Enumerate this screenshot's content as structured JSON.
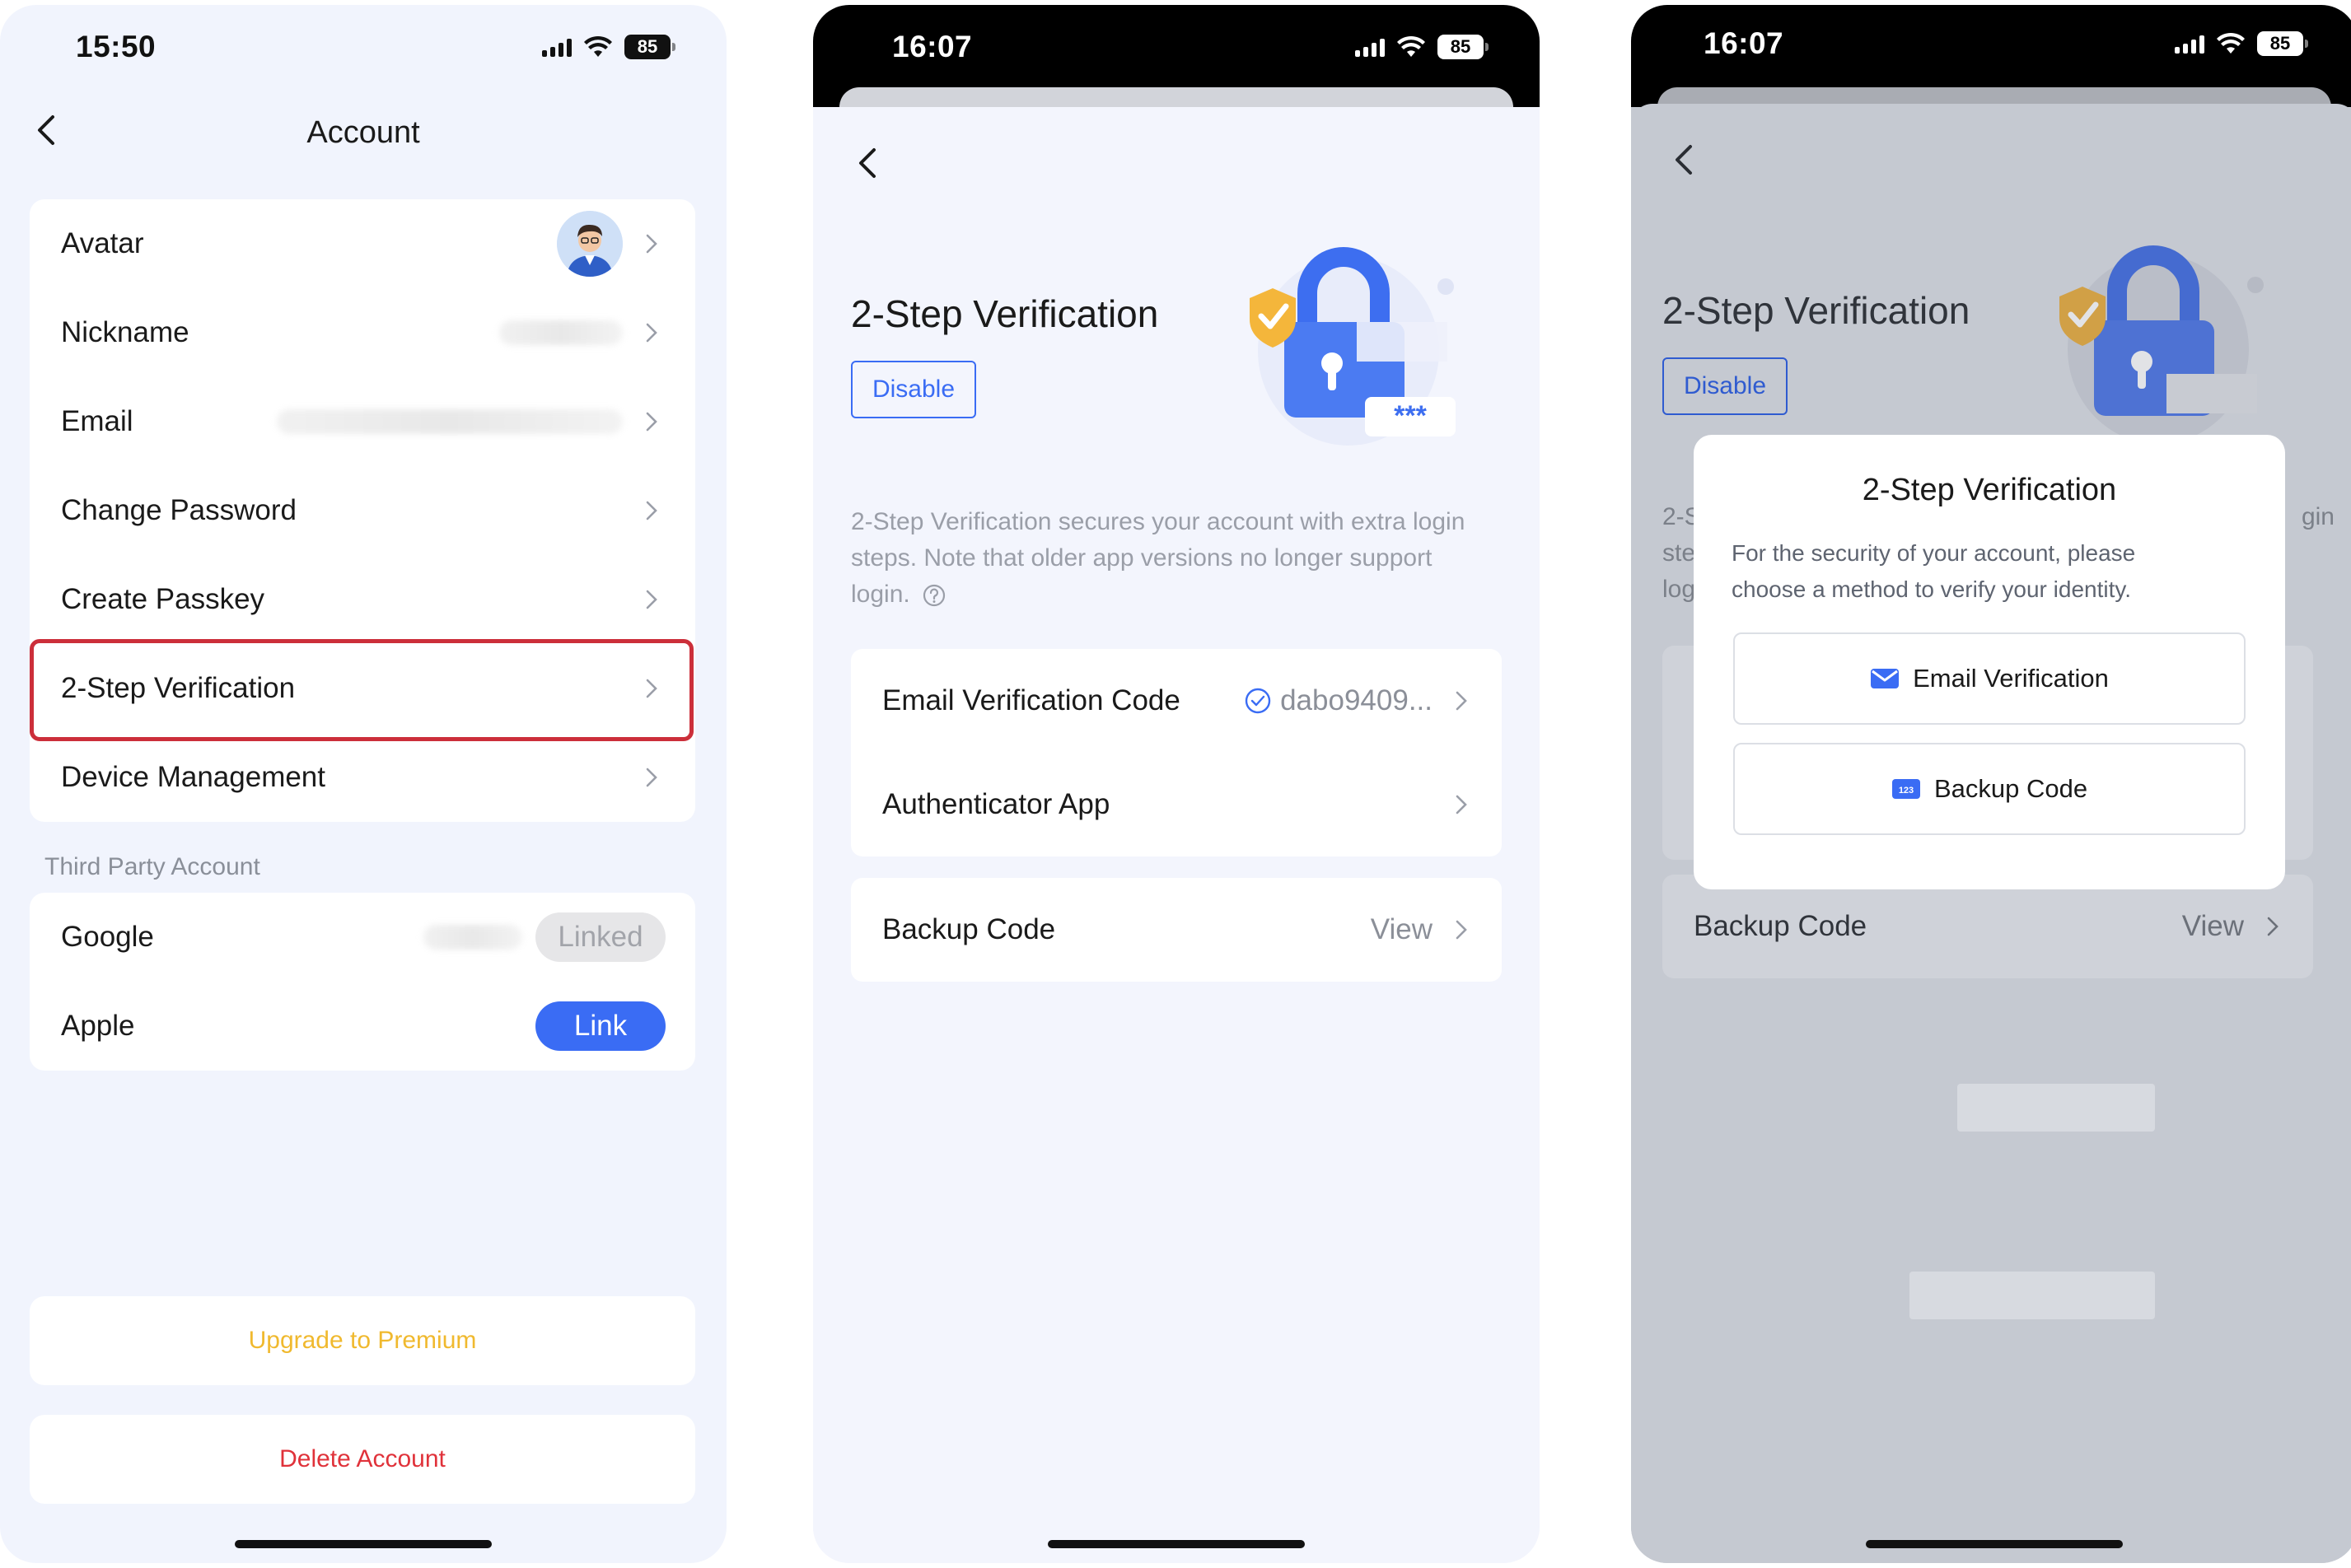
{
  "screens": [
    {
      "status": {
        "time": "15:50",
        "battery": "85"
      },
      "title": "Account",
      "rows": [
        {
          "label": "Avatar"
        },
        {
          "label": "Nickname"
        },
        {
          "label": "Email"
        },
        {
          "label": "Change Password"
        },
        {
          "label": "Create Passkey"
        },
        {
          "label": "2-Step Verification"
        },
        {
          "label": "Device Management"
        }
      ],
      "third_party_label": "Third Party Account",
      "third_party": [
        {
          "label": "Google",
          "action": "Linked"
        },
        {
          "label": "Apple",
          "action": "Link"
        }
      ],
      "upgrade_label": "Upgrade to Premium",
      "delete_label": "Delete Account",
      "colors": {
        "accent": "#3a6cf4",
        "highlight": "#cc2f3a",
        "upgrade": "#f0b92e",
        "delete": "#e0323a"
      }
    },
    {
      "status": {
        "time": "16:07",
        "battery": "85"
      },
      "title": "2-Step Verification",
      "disable_label": "Disable",
      "description_1": "2-Step Verification secures your account with extra login",
      "description_2": "steps. Note that older app versions no longer support",
      "description_3": "login.",
      "email_code_label": "Email Verification Code",
      "email_code_value": "dabo9409...",
      "authenticator_label": "Authenticator App",
      "backup_label": "Backup Code",
      "backup_value": "View"
    },
    {
      "status": {
        "time": "16:07",
        "battery": "85"
      },
      "title": "2-Step Verification",
      "disable_label": "Disable",
      "backup_label": "Backup Code",
      "backup_value": "View",
      "peek_left": [
        "2-S",
        "ste",
        "log"
      ],
      "peek_right": "gin",
      "modal": {
        "title": "2-Step Verification",
        "description_1": "For the security of your account, please",
        "description_2": "choose a method to verify your identity.",
        "option_email": "Email Verification",
        "option_backup": "Backup Code",
        "backup_icon_text": "123"
      }
    }
  ]
}
